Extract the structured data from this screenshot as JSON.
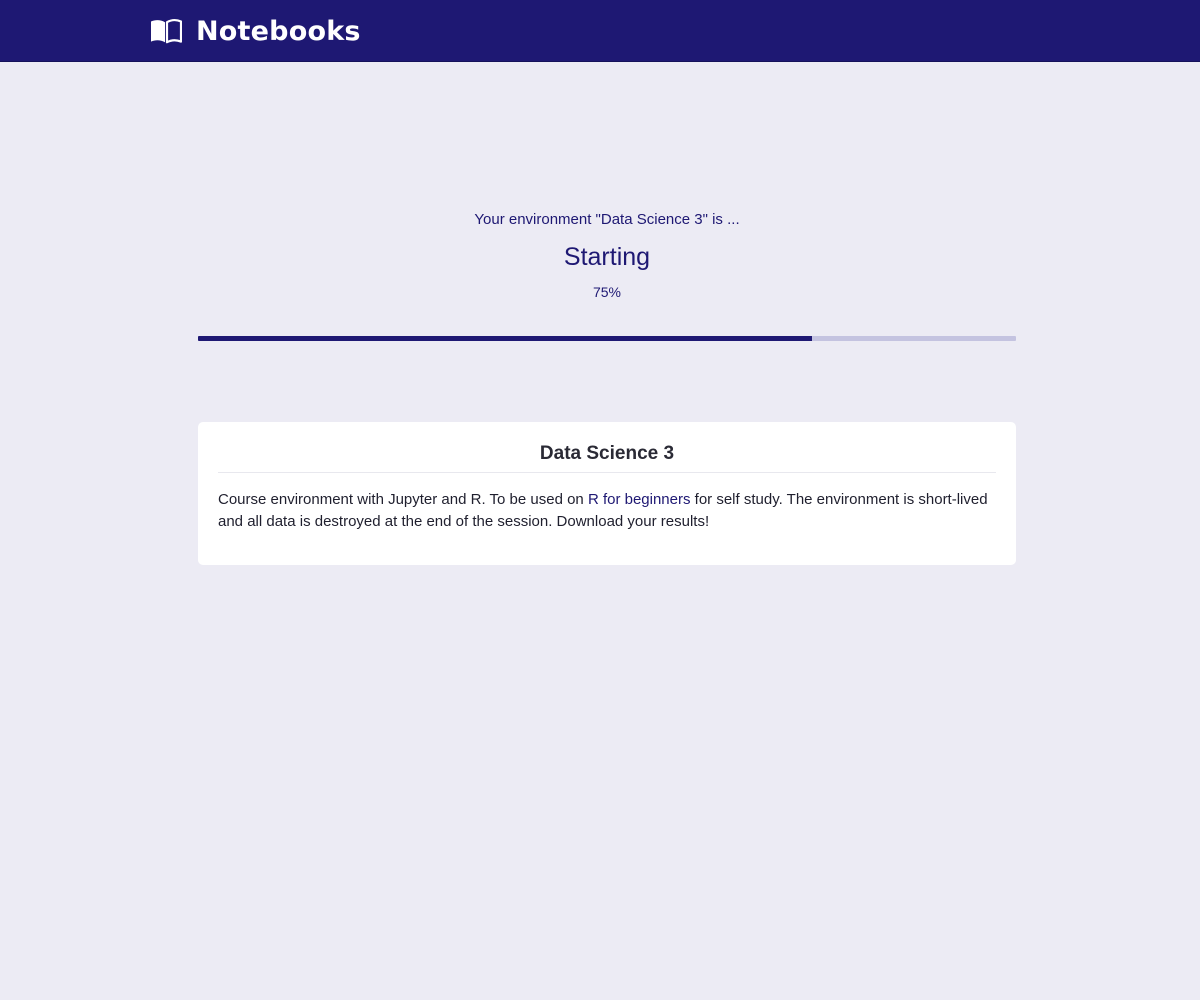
{
  "header": {
    "title": "Notebooks",
    "brand_icon": "open-book-icon",
    "background_color": "#1e1873"
  },
  "status": {
    "intro": "Your environment \"Data Science 3\" is ...",
    "state": "Starting",
    "percent_label": "75%",
    "progress": 0.75,
    "progress_color": "#1e1873",
    "progress_track_color": "#c4c3e0"
  },
  "card": {
    "title": "Data Science 3",
    "description_before": "Course environment with Jupyter and R. To be used on ",
    "link_text": "R for beginners",
    "description_after": " for self study. The environment is short-lived and all data is destroyed at the end of the session. Download your results!"
  }
}
